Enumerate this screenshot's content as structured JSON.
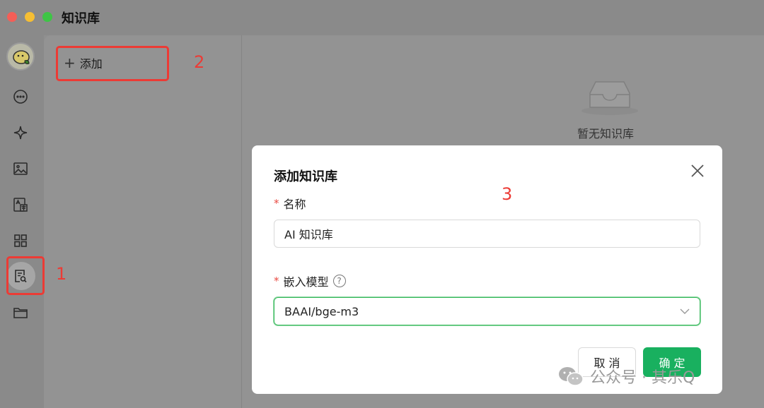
{
  "window": {
    "title": "知识库"
  },
  "sidebar": {
    "items": [
      {
        "icon": "chat-icon"
      },
      {
        "icon": "sparkle-icon"
      },
      {
        "icon": "image-icon"
      },
      {
        "icon": "translate-icon"
      },
      {
        "icon": "apps-grid-icon"
      },
      {
        "icon": "knowledge-search-icon",
        "active": true
      },
      {
        "icon": "folder-icon"
      }
    ]
  },
  "list_panel": {
    "add_label": "添加"
  },
  "content": {
    "empty_text": "暂无知识库"
  },
  "annotations": {
    "one": "1",
    "two": "2",
    "three": "3"
  },
  "dialog": {
    "title": "添加知识库",
    "required_mark": "*",
    "name_label": "名称",
    "name_value": "AI 知识库",
    "model_label": "嵌入模型",
    "help": "?",
    "model_value": "BAAI/bge-m3",
    "cancel_label": "取 消",
    "confirm_label": "确 定"
  },
  "watermark": {
    "text": "公众号 · 其乐Q"
  },
  "colors": {
    "accent": "#19b05f",
    "annotation": "#ec3b35",
    "required": "#e94b43"
  }
}
